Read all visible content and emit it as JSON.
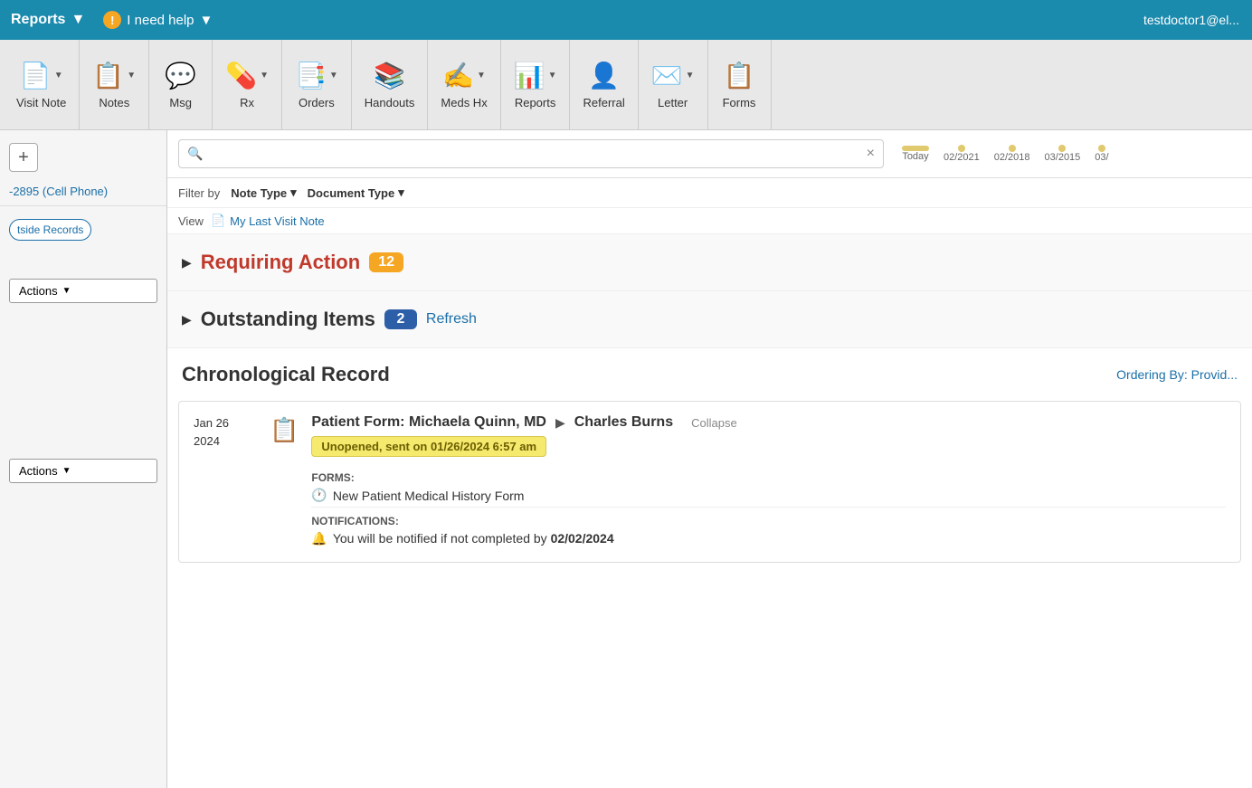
{
  "topbar": {
    "reports_label": "Reports",
    "reports_arrow": "▼",
    "help_label": "I need help",
    "help_arrow": "▼",
    "help_warning": "!",
    "user_label": "testdoctor1@el..."
  },
  "toolbar": {
    "items": [
      {
        "id": "visit-note",
        "label": "Visit Note",
        "icon": "📄",
        "has_arrow": true
      },
      {
        "id": "notes",
        "label": "Notes",
        "icon": "📋",
        "has_arrow": true
      },
      {
        "id": "msg",
        "label": "Msg",
        "icon": "💬",
        "has_arrow": false
      },
      {
        "id": "rx",
        "label": "Rx",
        "icon": "💊",
        "has_arrow": true
      },
      {
        "id": "orders",
        "label": "Orders",
        "icon": "📑",
        "has_arrow": true
      },
      {
        "id": "handouts",
        "label": "Handouts",
        "icon": "📚",
        "has_arrow": false
      },
      {
        "id": "meds-hx",
        "label": "Meds Hx",
        "icon": "✍️",
        "has_arrow": true
      },
      {
        "id": "reports",
        "label": "Reports",
        "icon": "📊",
        "has_arrow": true
      },
      {
        "id": "referral",
        "label": "Referral",
        "icon": "👤",
        "has_arrow": false
      },
      {
        "id": "letter",
        "label": "Letter",
        "icon": "✉️",
        "has_arrow": true
      },
      {
        "id": "forms",
        "label": "Forms",
        "icon": "📋",
        "has_arrow": false
      }
    ]
  },
  "sidebar": {
    "phone": "-2895 (Cell Phone)",
    "outside_records_label": "tside Records",
    "actions_label_1": "Actions",
    "actions_label_2": "Actions",
    "add_icon": "+"
  },
  "search": {
    "placeholder": "",
    "clear_icon": "×"
  },
  "timeline": {
    "labels": [
      "Today",
      "02/2021",
      "02/2018",
      "03/2015",
      "03/"
    ]
  },
  "filter": {
    "label": "Filter by",
    "note_type": "Note Type",
    "document_type": "Document Type",
    "arrow": "▾"
  },
  "view": {
    "label": "View",
    "last_visit_note": "My Last Visit Note",
    "doc_icon": "📄"
  },
  "sections": {
    "requiring_action": {
      "title": "Requiring Action",
      "badge": "12",
      "toggle": "▶"
    },
    "outstanding_items": {
      "title": "Outstanding Items",
      "badge": "2",
      "refresh": "Refresh",
      "toggle": "▶"
    },
    "chronological_record": {
      "title": "Chronological Record",
      "ordering_label": "Ordering By:",
      "ordering_value": "Provid..."
    }
  },
  "record_entry": {
    "date_line1": "Jan 26",
    "date_line2": "2024",
    "icon": "📋",
    "title": "Patient Form: Michaela Quinn, MD",
    "arrow": "▶",
    "patient": "Charles Burns",
    "collapse": "Collapse",
    "status_badge": "Unopened, sent on 01/26/2024 6:57 am",
    "forms_label": "FORMS:",
    "form_item": "New Patient Medical History Form",
    "notifications_label": "NOTIFICATIONS:",
    "notification_item_prefix": "You will be notified if not completed by ",
    "notification_date": "02/02/2024"
  }
}
